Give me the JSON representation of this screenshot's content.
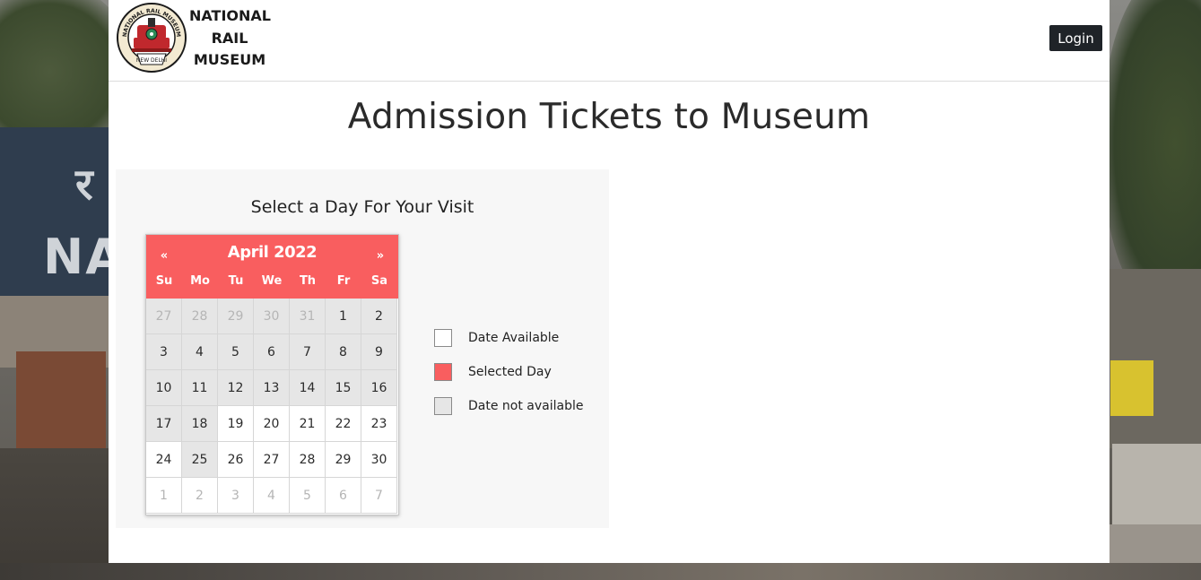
{
  "header": {
    "brand_lines": [
      "NATIONAL",
      "RAIL",
      "MUSEUM"
    ],
    "logo_text": "NATIONAL RAIL MUSEUM",
    "logo_bottom_text": "NEW DELHI",
    "login_label": "Login"
  },
  "page": {
    "title": "Admission Tickets to Museum",
    "select_heading": "Select a Day For Your Visit"
  },
  "calendar": {
    "month_label": "April 2022",
    "prev_label": "«",
    "next_label": "»",
    "weekdays": [
      "Su",
      "Mo",
      "Tu",
      "We",
      "Th",
      "Fr",
      "Sa"
    ],
    "days": [
      {
        "label": "27",
        "muted": true,
        "available": false
      },
      {
        "label": "28",
        "muted": true,
        "available": false
      },
      {
        "label": "29",
        "muted": true,
        "available": false
      },
      {
        "label": "30",
        "muted": true,
        "available": false
      },
      {
        "label": "31",
        "muted": true,
        "available": false
      },
      {
        "label": "1",
        "muted": false,
        "available": false
      },
      {
        "label": "2",
        "muted": false,
        "available": false
      },
      {
        "label": "3",
        "muted": false,
        "available": false
      },
      {
        "label": "4",
        "muted": false,
        "available": false
      },
      {
        "label": "5",
        "muted": false,
        "available": false
      },
      {
        "label": "6",
        "muted": false,
        "available": false
      },
      {
        "label": "7",
        "muted": false,
        "available": false
      },
      {
        "label": "8",
        "muted": false,
        "available": false
      },
      {
        "label": "9",
        "muted": false,
        "available": false
      },
      {
        "label": "10",
        "muted": false,
        "available": false
      },
      {
        "label": "11",
        "muted": false,
        "available": false
      },
      {
        "label": "12",
        "muted": false,
        "available": false
      },
      {
        "label": "13",
        "muted": false,
        "available": false
      },
      {
        "label": "14",
        "muted": false,
        "available": false
      },
      {
        "label": "15",
        "muted": false,
        "available": false
      },
      {
        "label": "16",
        "muted": false,
        "available": false
      },
      {
        "label": "17",
        "muted": false,
        "available": false
      },
      {
        "label": "18",
        "muted": false,
        "available": false
      },
      {
        "label": "19",
        "muted": false,
        "available": true
      },
      {
        "label": "20",
        "muted": false,
        "available": true
      },
      {
        "label": "21",
        "muted": false,
        "available": true
      },
      {
        "label": "22",
        "muted": false,
        "available": true
      },
      {
        "label": "23",
        "muted": false,
        "available": true
      },
      {
        "label": "24",
        "muted": false,
        "available": true
      },
      {
        "label": "25",
        "muted": false,
        "available": false
      },
      {
        "label": "26",
        "muted": false,
        "available": true
      },
      {
        "label": "27",
        "muted": false,
        "available": true
      },
      {
        "label": "28",
        "muted": false,
        "available": true
      },
      {
        "label": "29",
        "muted": false,
        "available": true
      },
      {
        "label": "30",
        "muted": false,
        "available": true
      },
      {
        "label": "1",
        "muted": true,
        "available": true
      },
      {
        "label": "2",
        "muted": true,
        "available": true
      },
      {
        "label": "3",
        "muted": true,
        "available": true
      },
      {
        "label": "4",
        "muted": true,
        "available": true
      },
      {
        "label": "5",
        "muted": true,
        "available": true
      },
      {
        "label": "6",
        "muted": true,
        "available": true
      },
      {
        "label": "7",
        "muted": true,
        "available": true
      }
    ]
  },
  "legend": [
    {
      "label": "Date Available",
      "color": "#ffffff"
    },
    {
      "label": "Selected Day",
      "color": "#f95e5f"
    },
    {
      "label": "Date not available",
      "color": "#e6e6e6"
    }
  ],
  "colors": {
    "accent": "#f95e5f",
    "unavailable": "#e6e6e6",
    "login_bg": "#1f2328"
  },
  "background": {
    "sign_text": "NA",
    "hindi_text": "र"
  }
}
